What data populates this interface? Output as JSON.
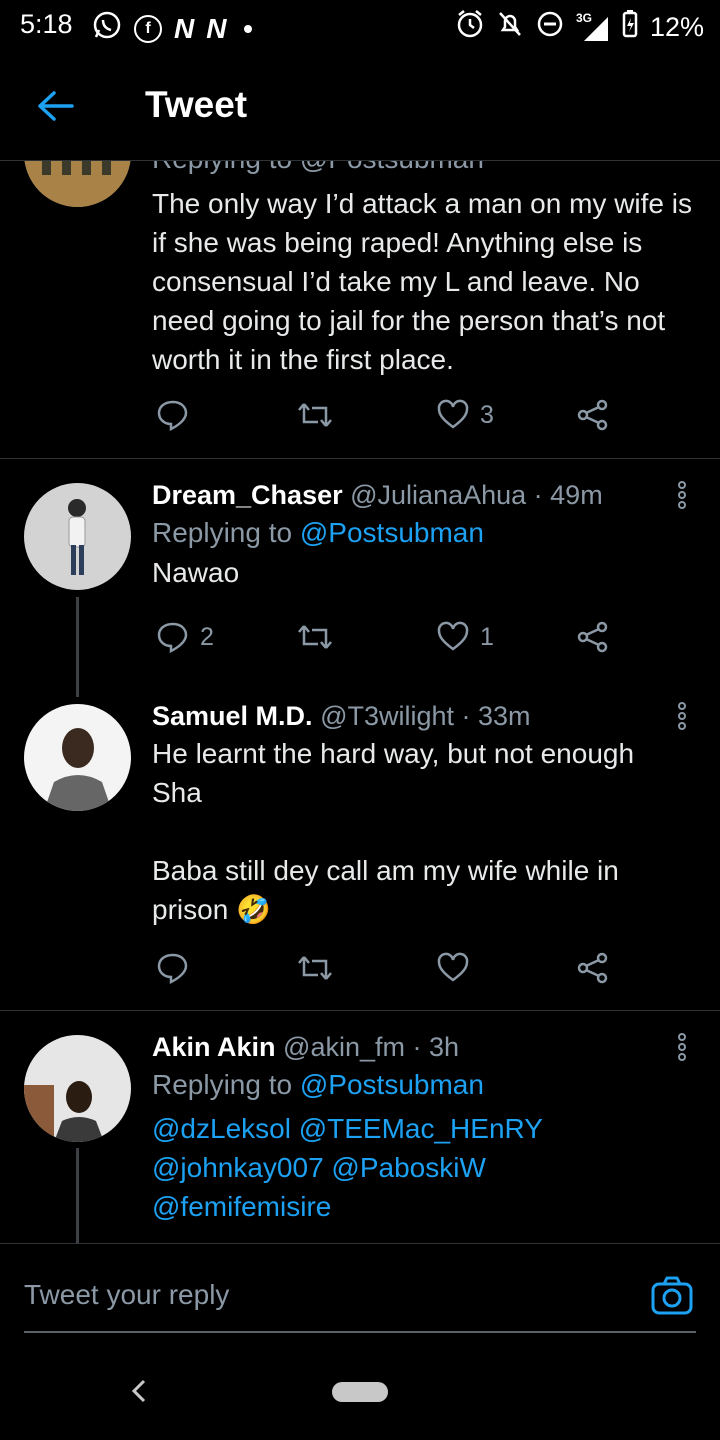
{
  "status_bar": {
    "time": "5:18",
    "left_icons": [
      "whatsapp-icon",
      "facebook-icon",
      "n-icon",
      "n-icon",
      "dot-icon"
    ],
    "n_label": "N",
    "network": "3G",
    "battery": "12%"
  },
  "header": {
    "title": "Tweet"
  },
  "tweets": [
    {
      "replying_partial": "Replying to @Postsubman",
      "text": "The only way I’d attack a man on my wife is if she was being raped! Anything else is consensual I’d take my L and leave. No need going to jail for the person that’s not worth it in the first place.",
      "replies": "",
      "retweets": "",
      "likes": "3"
    },
    {
      "name": "Dream_Chaser",
      "handle": "@JulianaAhua",
      "time": "· 49m",
      "replying_prefix": "Replying to",
      "replying_to": "@Postsubman",
      "text": "Nawao",
      "replies": "2",
      "likes": "1"
    },
    {
      "name": "Samuel M.D.",
      "handle": "@T3wilight",
      "time": "· 33m",
      "text_line1": "He learnt the hard way, but not enough",
      "text_line2": "Sha",
      "text_line3": "Baba still dey call am my wife while in",
      "text_line4": "prison 🤣",
      "replies": "",
      "likes": ""
    },
    {
      "name": "Akin Akin",
      "handle": "@akin_fm",
      "time": "· 3h",
      "replying_prefix": "Replying to",
      "replying_to": "@Postsubman",
      "mentions_line1": "@dzLeksol @TEEMac_HEnRY",
      "mentions_line2": "@johnkay007 @PaboskiW",
      "mentions_line3": "@femifemisire"
    }
  ],
  "reply_bar": {
    "placeholder": "Tweet your reply",
    "icon": "camera-icon"
  },
  "colors": {
    "accent": "#1da1f2",
    "background": "#000000",
    "muted": "#8b98a5",
    "divider": "#2f3336"
  }
}
